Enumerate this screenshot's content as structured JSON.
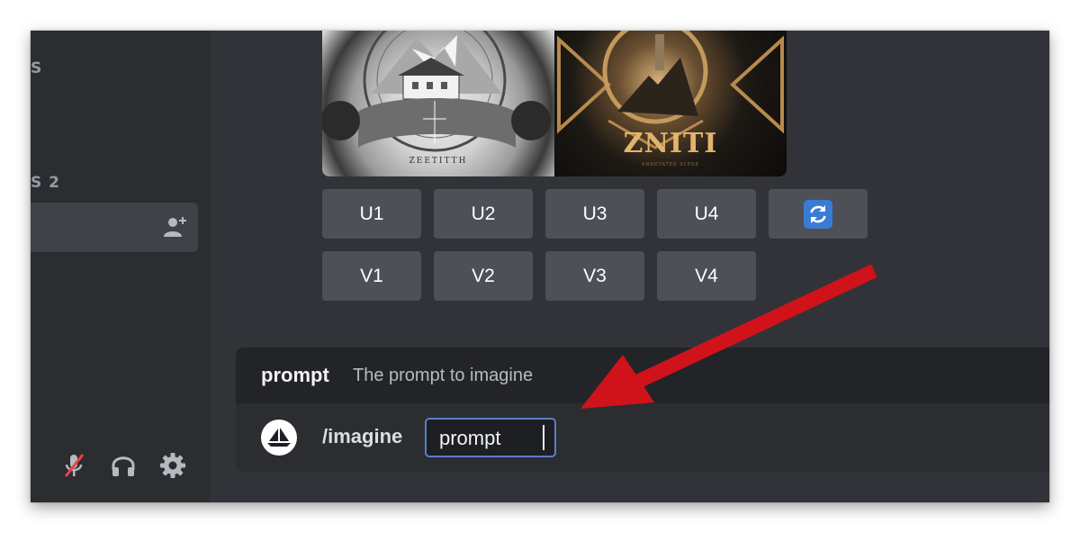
{
  "sidebar": {
    "fragment_top": "S",
    "fragment_mid": "S 2",
    "icons": {
      "invite": "add-member-icon",
      "mic": "muted-mic-icon",
      "headphones": "headphones-icon",
      "settings": "gear-icon"
    }
  },
  "images": {
    "left_title": "ZEETITTH",
    "right_title": "ZNITI",
    "right_subtitle": "ANNOTATED SCENE"
  },
  "buttons": {
    "upscale": [
      "U1",
      "U2",
      "U3",
      "U4"
    ],
    "variation": [
      "V1",
      "V2",
      "V3",
      "V4"
    ],
    "reroll_icon": "refresh-icon"
  },
  "prompt_hint": {
    "name": "prompt",
    "description": "The prompt to imagine"
  },
  "command": {
    "label": "/imagine",
    "option": "prompt"
  },
  "colors": {
    "background": "#313338",
    "sidebar": "#2b2d31",
    "button": "#4e5058",
    "arrow": "#d0121b",
    "accent": "#3a7bd5"
  }
}
